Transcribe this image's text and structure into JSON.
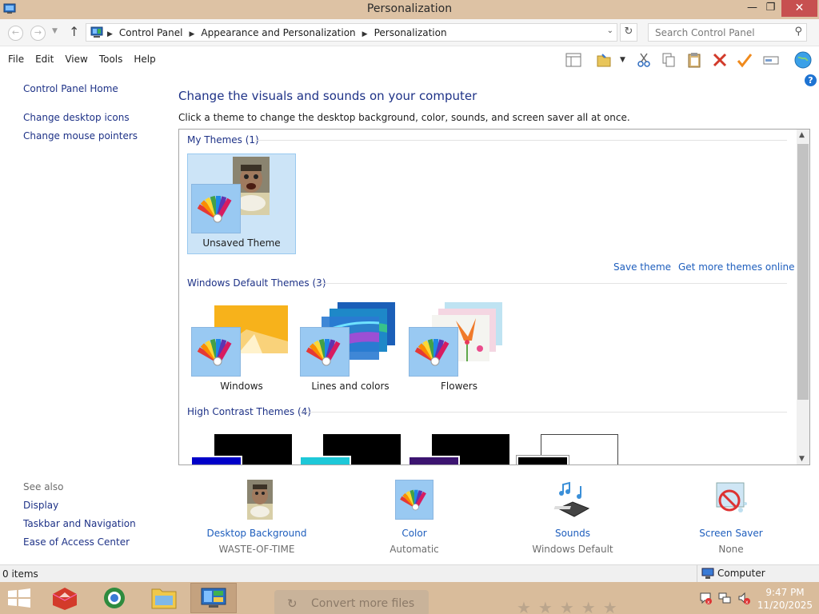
{
  "window": {
    "title": "Personalization"
  },
  "address": {
    "crumbs": [
      "Control Panel",
      "Appearance and Personalization",
      "Personalization"
    ],
    "search_placeholder": "Search Control Panel"
  },
  "menu": [
    "File",
    "Edit",
    "View",
    "Tools",
    "Help"
  ],
  "leftpane": {
    "links": [
      "Control Panel Home",
      "Change desktop icons",
      "Change mouse pointers"
    ],
    "see_also_title": "See also",
    "see_also": [
      "Display",
      "Taskbar and Navigation",
      "Ease of Access Center"
    ]
  },
  "main": {
    "title": "Change the visuals and sounds on your computer",
    "description": "Click a theme to change the desktop background, color, sounds, and screen saver all at once.",
    "my_themes": {
      "heading": "My Themes (1)",
      "themes": [
        {
          "label": "Unsaved Theme"
        }
      ],
      "save_theme": "Save theme",
      "get_more": "Get more themes online"
    },
    "default_themes": {
      "heading": "Windows Default Themes (3)",
      "themes": [
        {
          "label": "Windows"
        },
        {
          "label": "Lines and colors"
        },
        {
          "label": "Flowers"
        }
      ]
    },
    "high_contrast": {
      "heading": "High Contrast Themes (4)"
    }
  },
  "bottom": [
    {
      "name": "Desktop Background",
      "value": "WASTE-OF-TIME"
    },
    {
      "name": "Color",
      "value": "Automatic"
    },
    {
      "name": "Sounds",
      "value": "Windows Default"
    },
    {
      "name": "Screen Saver",
      "value": "None"
    }
  ],
  "status": {
    "items": "0 items",
    "location": "Computer"
  },
  "taskbar": {
    "convert_label": "Convert more files",
    "stars": "★★★★★",
    "time": "9:47 PM",
    "date": "11/20/2025"
  }
}
